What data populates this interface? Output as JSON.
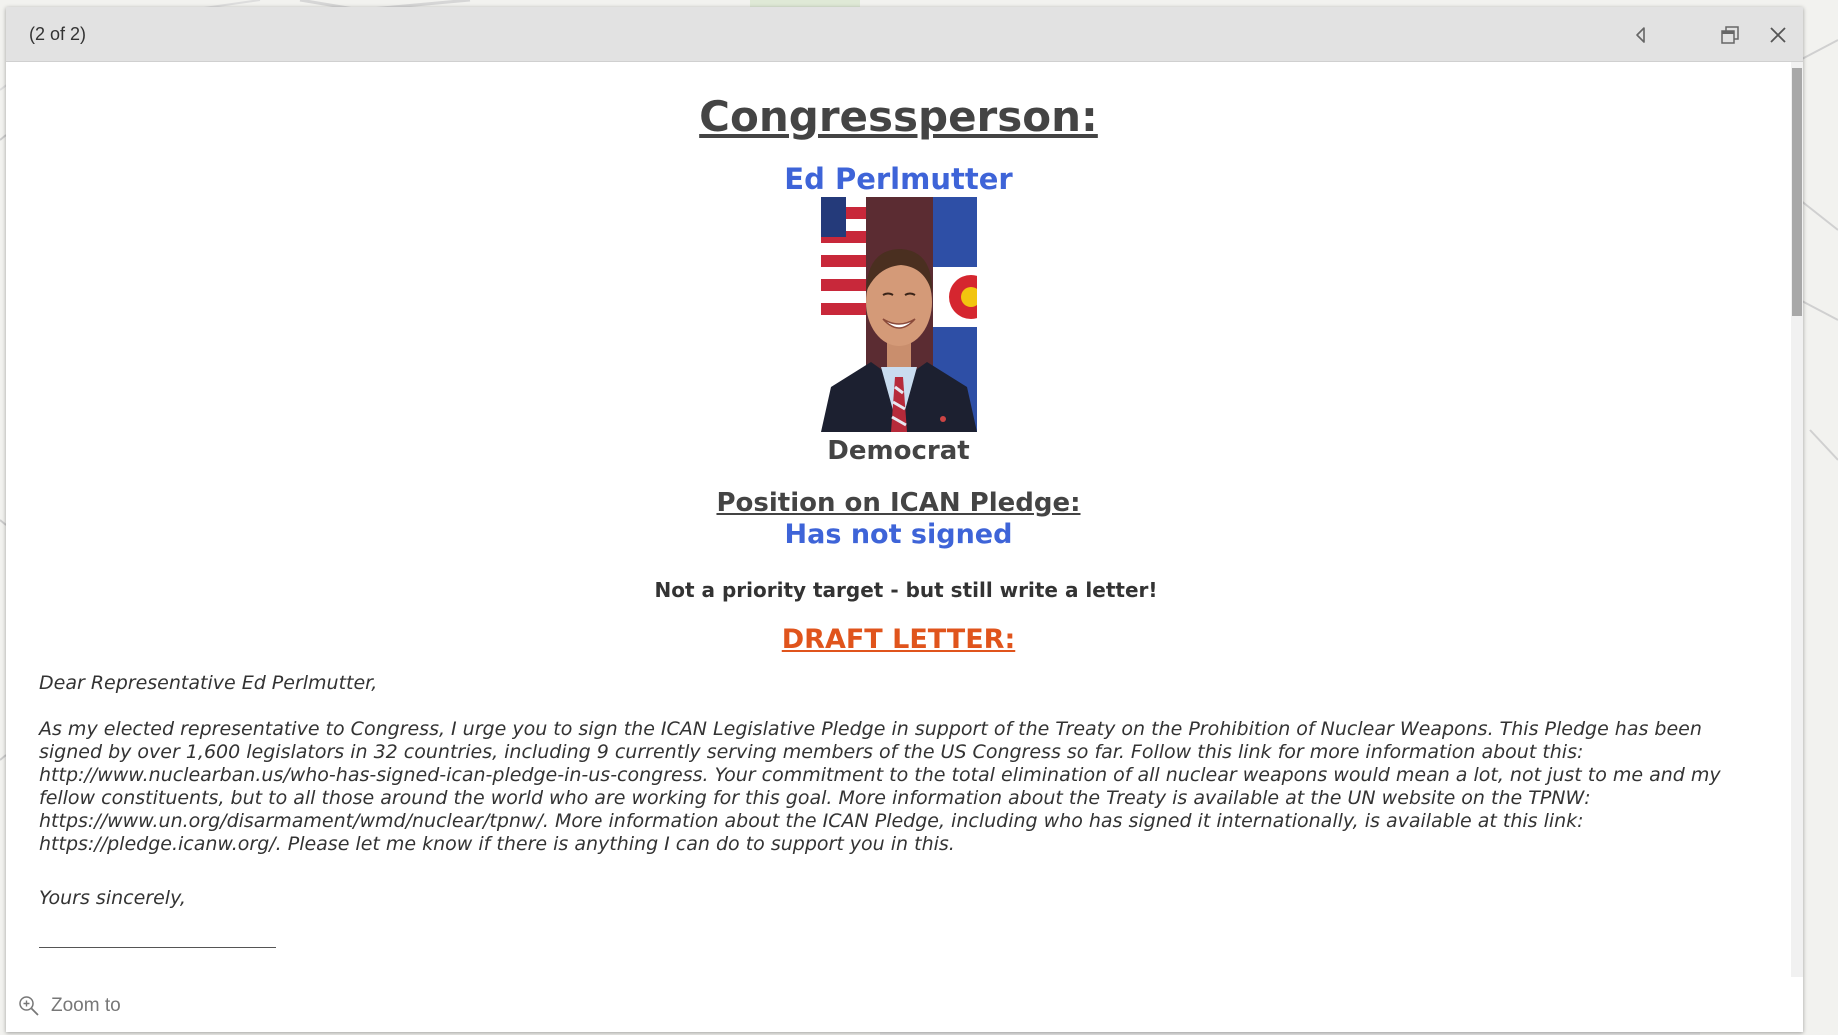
{
  "popup": {
    "count_text": "(2 of 2)"
  },
  "card": {
    "title": "Congressperson:",
    "name": "Ed Perlmutter",
    "party": "Democrat",
    "position_label": "Position on ICAN Pledge:",
    "position_value": "Has not signed",
    "priority_note": "Not a priority target - but still write a letter!",
    "draft_heading": "DRAFT LETTER:"
  },
  "letter": {
    "salutation": "Dear Representative Ed Perlmutter,",
    "body": "As my elected representative to Congress, I urge you to sign the ICAN Legislative Pledge in support of the Treaty on the Prohibition of Nuclear Weapons. This Pledge has been signed by over 1,600 legislators in 32 countries, including 9 currently serving members of the US Congress so far. Follow this link for more information about this: http://www.nuclearban.us/who-has-signed-ican-pledge-in-us-congress. Your commitment to the total elimination of all nuclear weapons would mean a lot, not just to me and my fellow constituents, but to all those around the world who are working for this goal. More information about the Treaty is available at the UN website on the TPNW: https://www.un.org/disarmament/wmd/nuclear/tpnw/. More information about the ICAN Pledge, including who has signed it internationally, is available at this link: https://pledge.icanw.org/. Please let me know if there is anything I can do to support you in this.",
    "closing": "Yours sincerely,"
  },
  "footer": {
    "zoom_label": "Zoom to"
  },
  "icons": {
    "previous": "triangle-left-icon",
    "dock": "dock-icon",
    "close": "close-icon",
    "zoom": "zoom-in-icon"
  },
  "colors": {
    "accent_blue": "#3e64d8",
    "draft_orange": "#e0541c",
    "header_gray": "#e2e2e2"
  }
}
